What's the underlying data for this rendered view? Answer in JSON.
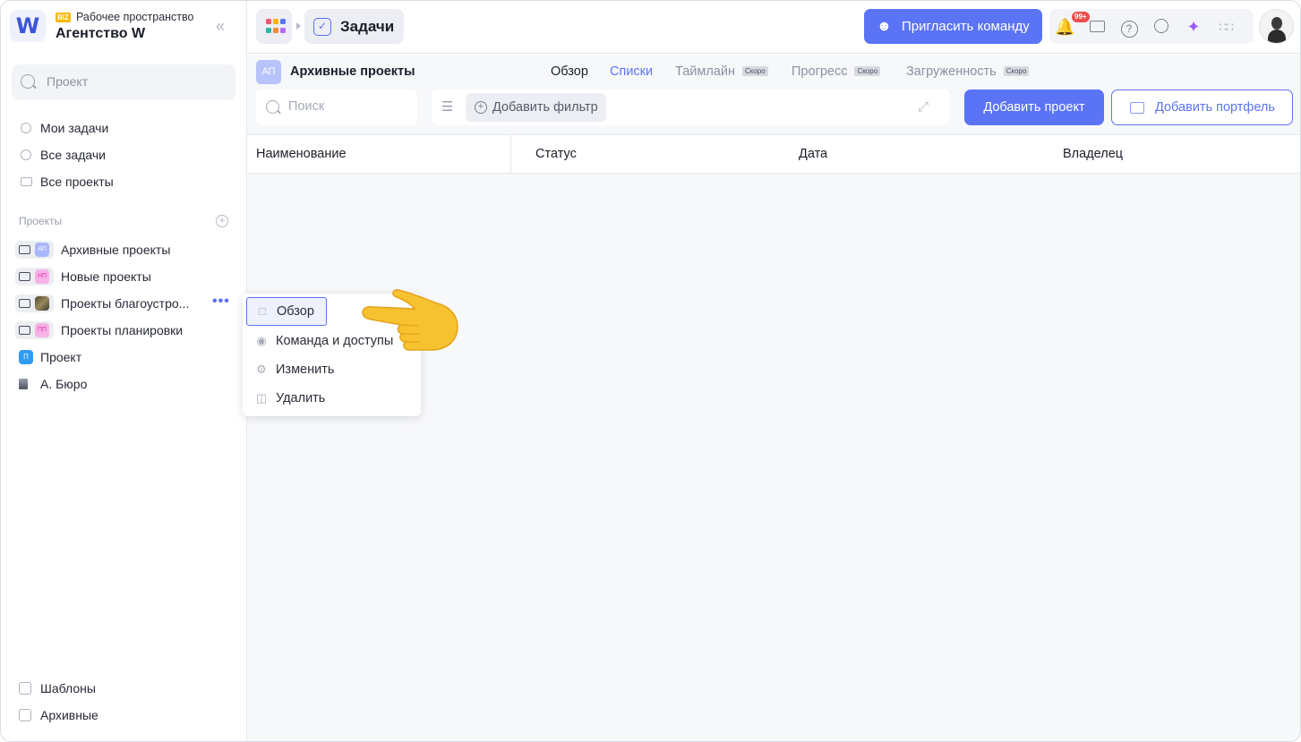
{
  "workspace": {
    "logo_letter": "W",
    "badge": "BIZ",
    "subtitle": "Рабочее пространство",
    "name": "Агентство W"
  },
  "sidebar": {
    "search_placeholder": "Проект",
    "nav": [
      {
        "label": "Мои задачи",
        "icon": "check-circle-icon"
      },
      {
        "label": "Все задачи",
        "icon": "check-circle-icon"
      },
      {
        "label": "Все проекты",
        "icon": "folder-icon"
      }
    ],
    "section_label": "Проекты",
    "projects": [
      {
        "tag": "АП",
        "label": "Архивные проекты",
        "tag_color": "#a9b6fb"
      },
      {
        "tag": "НП",
        "label": "Новые проекты",
        "tag_color": "#f7b2e6"
      },
      {
        "tag": "",
        "label": "Проекты благоустро...",
        "tag_color": "#7a6a4a"
      },
      {
        "tag": "ПП",
        "label": "Проекты планировки",
        "tag_color": "#f7b2e6"
      }
    ],
    "singles": [
      {
        "tag": "П",
        "label": "Проект",
        "tag_color": "#2f9cf4"
      },
      {
        "tag": "",
        "label": "А. Бюро",
        "tag_color": "#6b7080"
      }
    ],
    "footer": [
      {
        "label": "Шаблоны",
        "icon": "templates-icon"
      },
      {
        "label": "Архивные",
        "icon": "archive-icon"
      }
    ]
  },
  "topbar": {
    "crumb_label": "Задачи",
    "invite_label": "Пригласить команду",
    "notif_count": "99+"
  },
  "subheader": {
    "project_badge": "АП",
    "project_title": "Архивные проекты",
    "tabs": [
      {
        "label": "Обзор",
        "soon": ""
      },
      {
        "label": "Списки",
        "soon": ""
      },
      {
        "label": "Таймлайн",
        "soon": "Скоро"
      },
      {
        "label": "Прогресс",
        "soon": "Скоро"
      },
      {
        "label": "Загруженность",
        "soon": "Скоро"
      }
    ],
    "search_placeholder": "Поиск",
    "add_filter": "Добавить фильтр",
    "add_project": "Добавить проект",
    "add_portfolio": "Добавить портфель"
  },
  "table": {
    "columns": [
      "Наименование",
      "Статус",
      "Дата",
      "Владелец"
    ]
  },
  "context_menu": {
    "items": [
      {
        "label": "Обзор",
        "icon": "page-icon"
      },
      {
        "label": "Команда и доступы",
        "icon": "eye-icon"
      },
      {
        "label": "Изменить",
        "icon": "gear-icon"
      },
      {
        "label": "Удалить",
        "icon": "trash-icon"
      }
    ]
  },
  "colors": {
    "accent": "#5b74f5",
    "badge": "#ef4b4b"
  }
}
